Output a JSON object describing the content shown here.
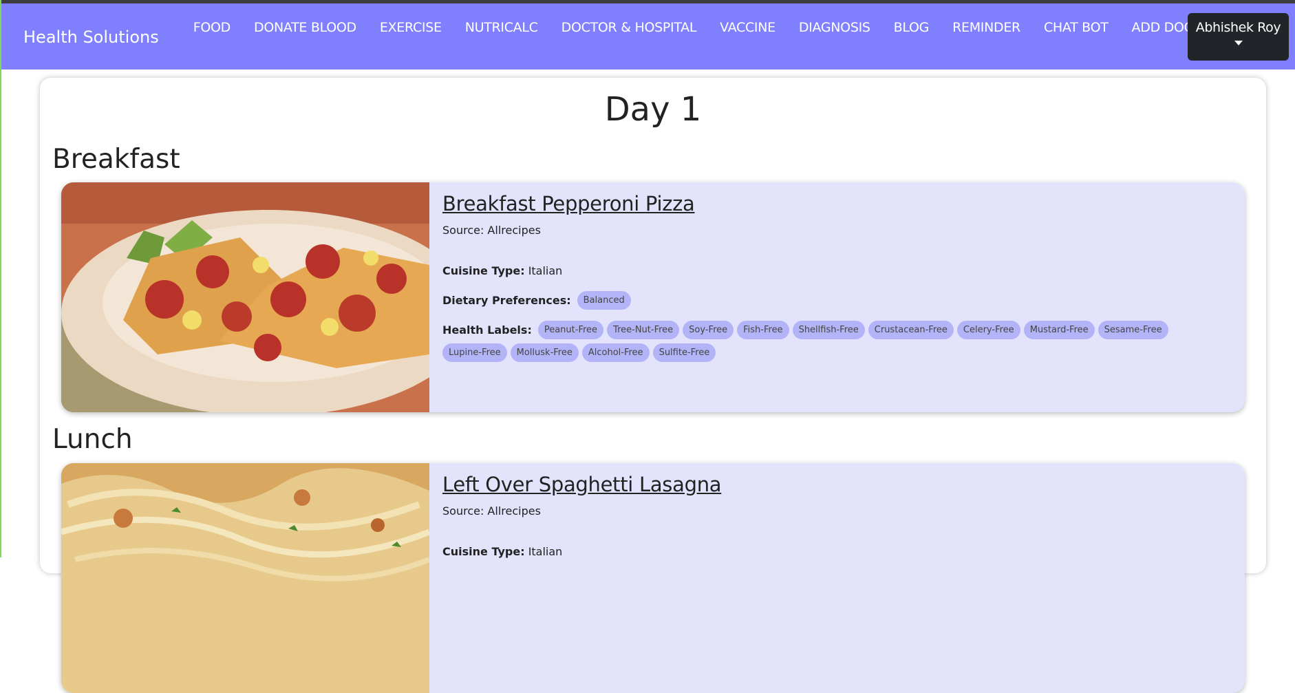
{
  "navbar": {
    "brand": "Health Solutions",
    "links": [
      "FOOD",
      "DONATE BLOOD",
      "EXERCISE",
      "NUTRICALC",
      "DOCTOR & HOSPITAL",
      "VACCINE",
      "DIAGNOSIS",
      "BLOG",
      "REMINDER",
      "CHAT BOT",
      "ADD DOCTOR"
    ],
    "user": "Abhishek Roy"
  },
  "day": {
    "title": "Day 1"
  },
  "breakfast": {
    "heading": "Breakfast",
    "title": "Breakfast Pepperoni Pizza",
    "source": "Source: Allrecipes",
    "cuisine_label": "Cuisine Type:",
    "cuisine": "Italian",
    "diet_label": "Dietary Preferences:",
    "diet_tags": [
      "Balanced"
    ],
    "health_label": "Health Labels:",
    "health_tags": [
      "Peanut-Free",
      "Tree-Nut-Free",
      "Soy-Free",
      "Fish-Free",
      "Shellfish-Free",
      "Crustacean-Free",
      "Celery-Free",
      "Mustard-Free",
      "Sesame-Free",
      "Lupine-Free",
      "Mollusk-Free",
      "Alcohol-Free",
      "Sulfite-Free"
    ]
  },
  "lunch": {
    "heading": "Lunch",
    "title": "Left Over Spaghetti Lasagna",
    "source": "Source: Allrecipes",
    "cuisine_label": "Cuisine Type:",
    "cuisine": "Italian"
  },
  "colors": {
    "navbar": "#8080ff",
    "card": "#e3e3fc",
    "tag": "#b3b3f7",
    "user_button": "#212529"
  }
}
